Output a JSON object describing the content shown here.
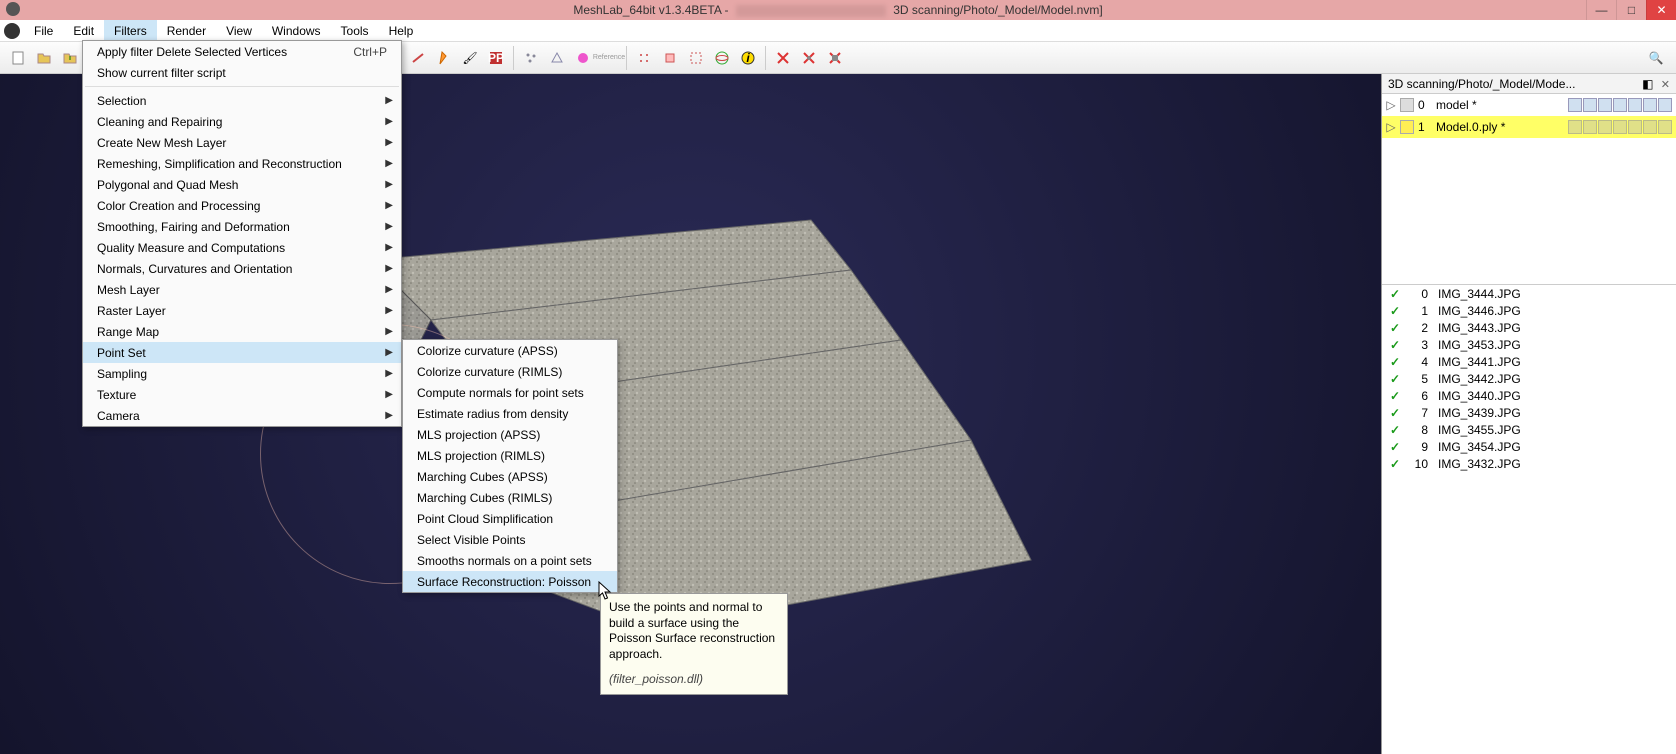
{
  "title": {
    "app": "MeshLab_64bit v1.3.4BETA - ",
    "path_suffix": " 3D scanning/Photo/_Model/Model.nvm]"
  },
  "menubar": [
    "File",
    "Edit",
    "Filters",
    "Render",
    "View",
    "Windows",
    "Tools",
    "Help"
  ],
  "menu1": {
    "top": [
      {
        "label": "Apply filter Delete Selected Vertices",
        "shortcut": "Ctrl+P"
      },
      {
        "label": "Show current filter script"
      }
    ],
    "groups": [
      "Selection",
      "Cleaning and Repairing",
      "Create New Mesh Layer",
      "Remeshing, Simplification and Reconstruction",
      "Polygonal and Quad Mesh",
      "Color Creation and Processing",
      "Smoothing, Fairing and Deformation",
      "Quality Measure and Computations",
      "Normals, Curvatures and Orientation",
      "Mesh Layer",
      "Raster Layer",
      "Range Map",
      "Point Set",
      "Sampling",
      "Texture",
      "Camera"
    ],
    "highlight": "Point Set"
  },
  "menu2": {
    "items": [
      "Colorize curvature (APSS)",
      "Colorize curvature (RIMLS)",
      "Compute normals for point sets",
      "Estimate radius from density",
      "MLS projection (APSS)",
      "MLS projection (RIMLS)",
      "Marching Cubes (APSS)",
      "Marching Cubes (RIMLS)",
      "Point Cloud Simplification",
      "Select Visible Points",
      "Smooths normals on a point sets",
      "Surface Reconstruction: Poisson"
    ],
    "highlight": "Surface Reconstruction: Poisson"
  },
  "tooltip": {
    "text": "Use the points and normal to build a surface using the Poisson Surface reconstruction approach.",
    "sub": "(filter_poisson.dll)"
  },
  "side": {
    "tab": "3D scanning/Photo/_Model/Mode...",
    "layers": [
      {
        "idx": "0",
        "name": "model *",
        "sel": false
      },
      {
        "idx": "1",
        "name": "Model.0.ply *",
        "sel": true
      }
    ],
    "images": [
      {
        "idx": "0",
        "name": "IMG_3444.JPG"
      },
      {
        "idx": "1",
        "name": "IMG_3446.JPG"
      },
      {
        "idx": "2",
        "name": "IMG_3443.JPG"
      },
      {
        "idx": "3",
        "name": "IMG_3453.JPG"
      },
      {
        "idx": "4",
        "name": "IMG_3441.JPG"
      },
      {
        "idx": "5",
        "name": "IMG_3442.JPG"
      },
      {
        "idx": "6",
        "name": "IMG_3440.JPG"
      },
      {
        "idx": "7",
        "name": "IMG_3439.JPG"
      },
      {
        "idx": "8",
        "name": "IMG_3455.JPG"
      },
      {
        "idx": "9",
        "name": "IMG_3454.JPG"
      },
      {
        "idx": "10",
        "name": "IMG_3432.JPG"
      }
    ]
  }
}
